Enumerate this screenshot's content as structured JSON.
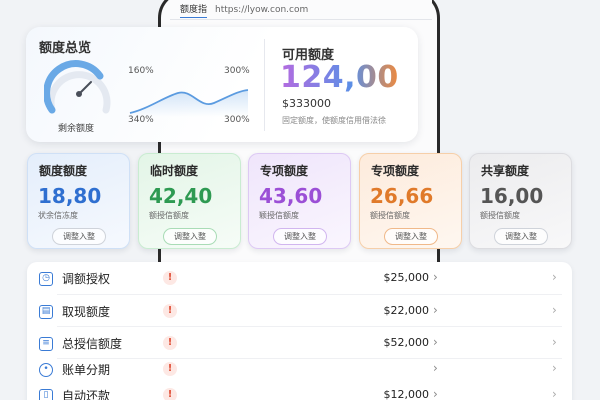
{
  "browser": {
    "tab_label": "额度指",
    "url": "https://lyow.con.com"
  },
  "overview": {
    "title": "额度总览",
    "gauge_caption": "剩余额度",
    "spark_labels": {
      "top_left": "160%",
      "top_right": "300%",
      "bottom_left": "340%",
      "bottom_right": "300%"
    },
    "available_title": "可用额度",
    "available_value": "124,00",
    "available_amount": "$333000",
    "available_note": "固定额度，使额度信用借法徐"
  },
  "quota_cards": [
    {
      "name": "额度额度",
      "value": "18,80",
      "sub": "状余信冻度",
      "button": "调整入整"
    },
    {
      "name": "临时额度",
      "value": "42,40",
      "sub": "额授信额度",
      "button": "调整入整"
    },
    {
      "name": "专项额度",
      "value": "43,60",
      "sub": "颖授信额度",
      "button": "调整入整"
    },
    {
      "name": "专项额度",
      "value": "26,66",
      "sub": "额授信额度",
      "button": "调整入整"
    },
    {
      "name": "共享额度",
      "value": "16,00",
      "sub": "额授信额度",
      "button": "调整入整"
    }
  ],
  "list_items": [
    {
      "label": "调额授权",
      "icon": "clock-icon",
      "amount": "$25,000"
    },
    {
      "label": "取现额度",
      "icon": "calendar-icon",
      "amount": "$22,000"
    },
    {
      "label": "总授信额度",
      "icon": "document-icon",
      "amount": "$52,000"
    },
    {
      "label": "账单分期",
      "icon": "user-icon",
      "amount": ""
    },
    {
      "label": "自动还款",
      "icon": "trash-icon",
      "amount": "$12,000"
    }
  ],
  "colors": {
    "accent": "#3a7bd5",
    "green": "#2e9a52",
    "purple": "#9b4fd6",
    "orange": "#e07a2a"
  }
}
